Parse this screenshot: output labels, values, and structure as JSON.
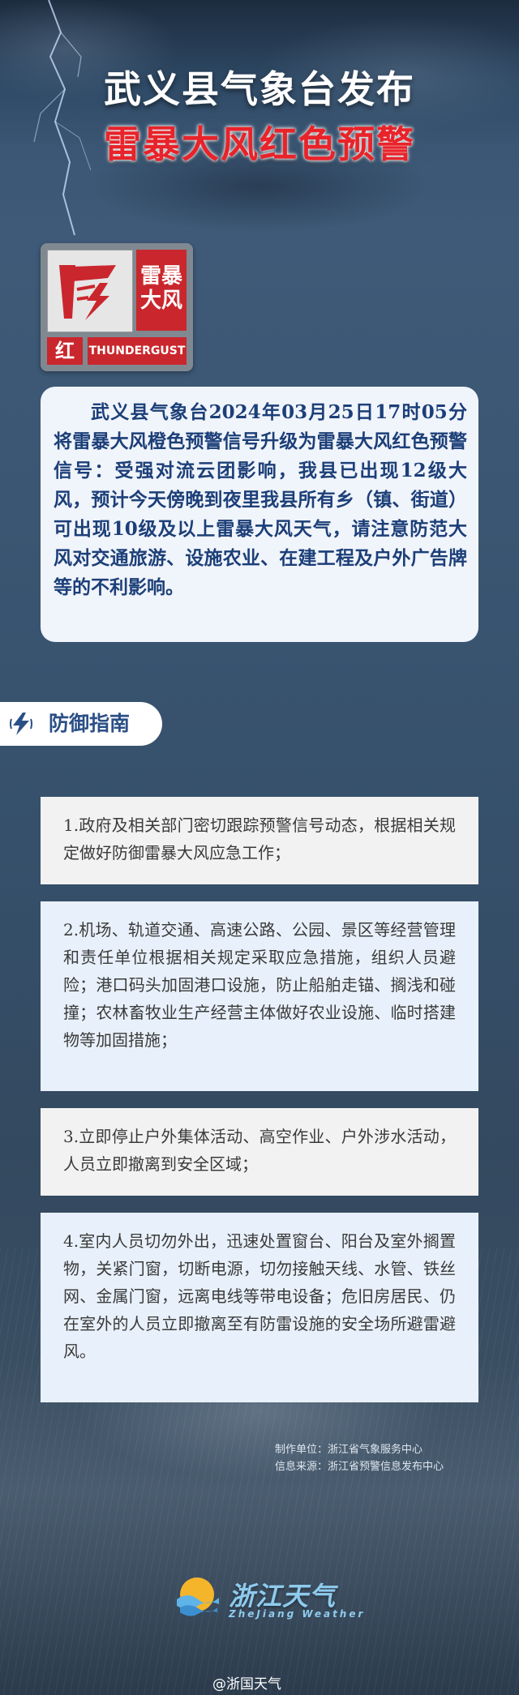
{
  "header": {
    "title_line1": "武义县气象台发布",
    "title_line2": "雷暴大风红色预警"
  },
  "warning_sign": {
    "name_line1": "雷暴",
    "name_line2": "大风",
    "level": "红",
    "english": "THUNDERGUST",
    "icon": "thunder-gust-icon",
    "color": "#c9272d"
  },
  "intro_text": "武义县气象台2024年03月25日17时05分将雷暴大风橙色预警信号升级为雷暴大风红色预警信号：受强对流云团影响，我县已出现12级大风，预计今天傍晚到夜里我县所有乡（镇、街道）可出现10级及以上雷暴大风天气，请注意防范大风对交通旅游、设施农业、在建工程及户外广告牌等的不利影响。",
  "guide": {
    "heading": "防御指南",
    "items": [
      "1.政府及相关部门密切跟踪预警信号动态，根据相关规定做好防御雷暴大风应急工作；",
      "2.机场、轨道交通、高速公路、公园、景区等经营管理和责任单位根据相关规定采取应急措施，组织人员避险；港口码头加固港口设施，防止船舶走锚、搁浅和碰撞；农林畜牧业生产经营主体做好农业设施、临时搭建物等加固措施；",
      "3.立即停止户外集体活动、高空作业、户外涉水活动，人员立即撤离到安全区域；",
      "4.室内人员切勿外出，迅速处置窗台、阳台及室外搁置物，关紧门窗，切断电源，切勿接触天线、水管、铁丝网、金属门窗，远离电线等带电设备；危旧房居民、仍在室外的人员立即撤离至有防雷设施的安全场所避雷避风。"
    ]
  },
  "credits": {
    "producer": "制作单位：浙江省气象服务中心",
    "source": "信息来源：浙江省预警信息发布中心"
  },
  "logo": {
    "name_cn": "浙江天气",
    "name_en": "ZheJiang Weather"
  },
  "watermark": "@浙国天气",
  "colors": {
    "title_red": "#e8232a",
    "intro_text": "#1c3f78",
    "guide_heading": "#2b4f86"
  }
}
